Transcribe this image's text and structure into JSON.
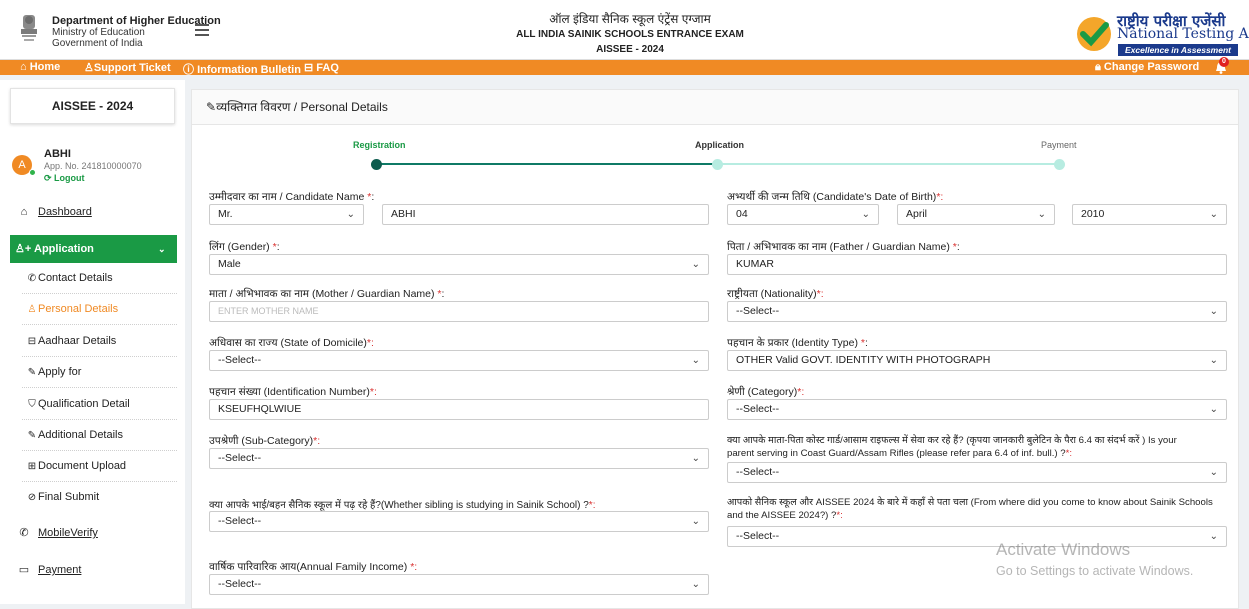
{
  "header": {
    "dept_name": "Department of Higher Education",
    "dept_ministry": "Ministry of Education",
    "dept_gov": "Government of India",
    "title_hindi": "ऑल इंडिया सैनिक स्कूल एंट्रेंस एग्जाम",
    "title_en": "ALL INDIA SAINIK SCHOOLS ENTRANCE EXAM",
    "title_exam": "AISSEE - 2024",
    "nta_hindi": "राष्ट्रीय परीक्षा एजेंसी",
    "nta_en": "National Testing Agency",
    "nta_tagline": "Excellence in Assessment"
  },
  "navbar": {
    "home": "Home",
    "support": "Support Ticket",
    "bulletin": "Information Bulletin",
    "faq": "FAQ",
    "change_password": "Change Password",
    "notif_count": "0"
  },
  "sidebar": {
    "exam": "AISSEE - 2024",
    "avatar_letter": "A",
    "user_name": "ABHI",
    "app_no": "App. No. 241810000070",
    "logout": "Logout",
    "dashboard": "Dashboard",
    "application": "Application",
    "subitems": [
      {
        "label": "Contact Details",
        "icon": "phone-icon"
      },
      {
        "label": "Personal Details",
        "icon": "person-icon"
      },
      {
        "label": "Aadhaar Details",
        "icon": "card-icon"
      },
      {
        "label": "Apply for",
        "icon": "pen-icon"
      },
      {
        "label": "Qualification Detail",
        "icon": "shield-icon"
      },
      {
        "label": "Additional Details",
        "icon": "pen-icon"
      },
      {
        "label": "Document Upload",
        "icon": "upload-icon"
      },
      {
        "label": "Final Submit",
        "icon": "check-circle-icon"
      }
    ],
    "mobile_verify": "MobileVerify",
    "payment": "Payment"
  },
  "panel": {
    "title": "व्यक्तिगत विवरण / Personal Details",
    "steps": [
      "Registration",
      "Application",
      "Payment"
    ]
  },
  "form": {
    "candidate_name_label": "उम्मीदवार का नाम / Candidate Name ",
    "salutation": "Mr.",
    "candidate_name": "ABHI",
    "dob_label": "अभ्यर्थी की जन्म तिथि (Candidate's Date of Birth)",
    "dob_day": "04",
    "dob_month": "April",
    "dob_year": "2010",
    "gender_label": "लिंग (Gender) ",
    "gender": "Male",
    "father_label": "पिता / अभिभावक का नाम (Father / Guardian Name) ",
    "father": "KUMAR",
    "mother_label": "माता / अभिभावक का नाम (Mother / Guardian Name) ",
    "mother_placeholder": "ENTER MOTHER NAME",
    "nationality_label": "राष्ट्रीयता (Nationality)",
    "nationality": "--Select--",
    "domicile_label": "अधिवास का राज्य (State of Domicile)",
    "domicile": "--Select--",
    "identity_type_label": "पहचान के प्रकार (Identity Type) ",
    "identity_type": "OTHER Valid GOVT. IDENTITY WITH PHOTOGRAPH",
    "id_number_label": "पहचान संख्या (Identification Number)",
    "id_number": "KSEUFHQLWIUE",
    "category_label": "श्रेणी (Category)",
    "category": "--Select--",
    "subcategory_label": "उपश्रेणी (Sub-Category)",
    "subcategory": "--Select--",
    "coast_guard_label_1": "क्या आपके माता-पिता कोस्ट गार्ड/आसाम राइफल्स में सेवा कर रहे हैं? (कृपया जानकारी बुलेटिन के पैरा 6.4 का संदर्भ करें ) Is your",
    "coast_guard_label_2": "parent serving in Coast Guard/Assam Rifles (please refer para 6.4 of inf. bull.) ?",
    "coast_guard": "--Select--",
    "sibling_label": "क्या आपके भाई/बहन सैनिक स्कूल में पढ़ रहे हैं?(Whether sibling is studying in Sainik School) ?",
    "sibling": "--Select--",
    "source_label_1": "आपको सैनिक स्कूल और AISSEE 2024 के बारे में कहाँ से पता चला (From where did you come to know about Sainik Schools",
    "source_label_2": "and the AISSEE 2024?) ?",
    "source": "--Select--",
    "income_label": "वार्षिक पारिवारिक आय(Annual Family Income) ",
    "income": "--Select--",
    "required_mark": "*",
    "required_colon": "*:",
    "colon": ":"
  },
  "watermark": {
    "line1": "Activate Windows",
    "line2": "Go to Settings to activate Windows."
  },
  "colors": {
    "accent_orange": "#f08a24",
    "accent_green": "#1a9a45",
    "step_teal": "#0f7a66",
    "nta_blue": "#1b3a8c"
  }
}
